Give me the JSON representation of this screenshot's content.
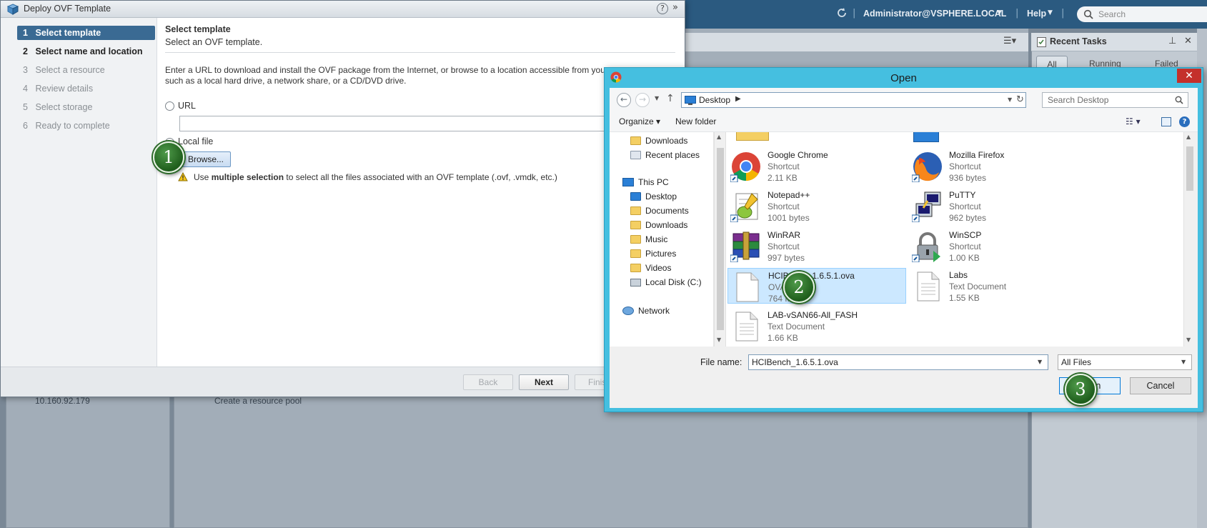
{
  "vsphere": {
    "user": "Administrator@VSPHERE.LOCAL",
    "help": "Help",
    "search_placeholder": "Search",
    "recent_tasks_title": "Recent Tasks",
    "task_tabs": [
      "All",
      "Running",
      "Failed"
    ],
    "tree_ghost": "10.160.92.179",
    "center_ghost": "Create a resource pool"
  },
  "ovf": {
    "title": "Deploy OVF Template",
    "nav": [
      {
        "num": "1",
        "label": "Select template"
      },
      {
        "num": "2",
        "label": "Select name and location"
      },
      {
        "num": "3",
        "label": "Select a resource"
      },
      {
        "num": "4",
        "label": "Review details"
      },
      {
        "num": "5",
        "label": "Select storage"
      },
      {
        "num": "6",
        "label": "Ready to complete"
      }
    ],
    "heading": "Select template",
    "subheading": "Select an OVF template.",
    "desc_line1": "Enter a URL to download and install the OVF package from the Internet, or browse to a location accessible from your computer,",
    "desc_line2": "such as a local hard drive, a network share, or a CD/DVD drive.",
    "url_label": "URL",
    "local_label": "Local file",
    "browse_label": "Browse...",
    "hint_pre": "Use ",
    "hint_bold": "multiple selection",
    "hint_post": " to select all the files associated with an OVF template (.ovf, .vmdk, etc.)",
    "back_label": "Back",
    "next_label": "Next",
    "finish_label": "Finish"
  },
  "open": {
    "title": "Open",
    "close": "✕",
    "path": "Desktop",
    "search_placeholder": "Search Desktop",
    "organize": "Organize",
    "new_folder": "New folder",
    "tree": [
      {
        "label": "Downloads"
      },
      {
        "label": "Recent places"
      },
      {
        "label": "This PC"
      },
      {
        "label": "Desktop"
      },
      {
        "label": "Documents"
      },
      {
        "label": "Downloads"
      },
      {
        "label": "Music"
      },
      {
        "label": "Pictures"
      },
      {
        "label": "Videos"
      },
      {
        "label": "Local Disk (C:)"
      },
      {
        "label": "Network"
      }
    ],
    "files": [
      {
        "name": "Google Chrome",
        "type": "Shortcut",
        "size": "2.11 KB",
        "icon": "chrome-icon"
      },
      {
        "name": "Mozilla Firefox",
        "type": "Shortcut",
        "size": "936 bytes",
        "icon": "firefox-icon"
      },
      {
        "name": "Notepad++",
        "type": "Shortcut",
        "size": "1001 bytes",
        "icon": "notepadpp-icon"
      },
      {
        "name": "PuTTY",
        "type": "Shortcut",
        "size": "962 bytes",
        "icon": "putty-icon"
      },
      {
        "name": "WinRAR",
        "type": "Shortcut",
        "size": "997 bytes",
        "icon": "winrar-icon"
      },
      {
        "name": "WinSCP",
        "type": "Shortcut",
        "size": "1.00 KB",
        "icon": "winscp-icon"
      },
      {
        "name": "HCIBench_1.6.5.1.ova",
        "type": "OVA File",
        "size": "764 MB",
        "icon": "document-icon"
      },
      {
        "name": "Labs",
        "type": "Text Document",
        "size": "1.55 KB",
        "icon": "text-doc-icon"
      },
      {
        "name": "LAB-vSAN66-All_FASH",
        "type": "Text Document",
        "size": "1.66 KB",
        "icon": "text-doc-icon"
      }
    ],
    "filename_label": "File name:",
    "filename_value": "HCIBench_1.6.5.1.ova",
    "filetype_value": "All Files",
    "open_label": "Open",
    "cancel_label": "Cancel"
  },
  "markers": [
    "1",
    "2",
    "3"
  ]
}
